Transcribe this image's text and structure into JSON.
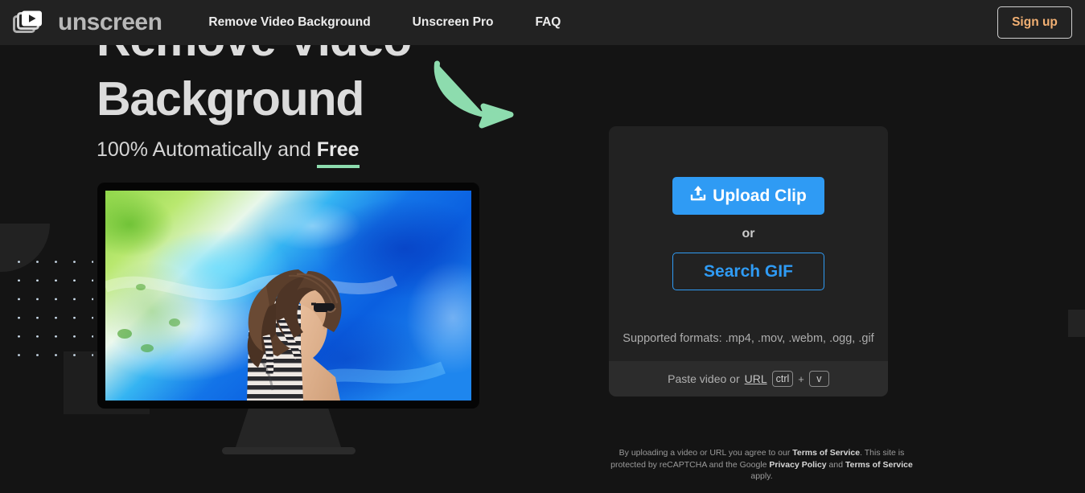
{
  "navbar": {
    "logo_icon": "video-frames-play-icon",
    "logo_text": "unscreen",
    "links": [
      {
        "label": "Remove Video Background",
        "name": "nav-link-remove-video-background"
      },
      {
        "label": "Unscreen Pro",
        "name": "nav-link-unscreen-pro"
      },
      {
        "label": "FAQ",
        "name": "nav-link-faq"
      }
    ],
    "signup_label": "Sign up",
    "signup_color": "#f2b073",
    "background": "#222222"
  },
  "hero": {
    "headline_line1": "Remove Video",
    "headline_line2": "Background",
    "subhead_prefix": "100% Automatically and ",
    "subhead_emphasis": "Free",
    "underline_color": "#8ddcae",
    "arrow_icon": "curved-arrow-down-right-icon",
    "arrow_color": "#8ddcae"
  },
  "preview": {
    "monitor_icon": "desktop-monitor",
    "video_alt": "woman-in-striped-top-against-blue-green-abstract-background"
  },
  "upload": {
    "upload_icon": "upload-tray-icon",
    "upload_label": "Upload Clip",
    "upload_color": "#2f9bf4",
    "or_label": "or",
    "search_gif_label": "Search GIF",
    "formats_label": "Supported formats: .mp4, .mov, .webm, .ogg, .gif",
    "paste_prefix": "Paste video or ",
    "paste_url_link": "URL",
    "key_ctrl": "ctrl",
    "key_plus": "+",
    "key_v": "v"
  },
  "legal": {
    "l1a": "By uploading a video or URL you agree to our ",
    "l1b": "Terms of Service",
    "l1c": ". This site is protected",
    "l2a": "by reCAPTCHA and the Google ",
    "l2b": "Privacy Policy",
    "l2c": " and ",
    "l2d": "Terms of Service",
    "l2e": " apply."
  },
  "theme": {
    "page_background": "#141414",
    "card_background": "#222222",
    "accent_blue": "#2f9bf4",
    "accent_green": "#8ddcae"
  }
}
